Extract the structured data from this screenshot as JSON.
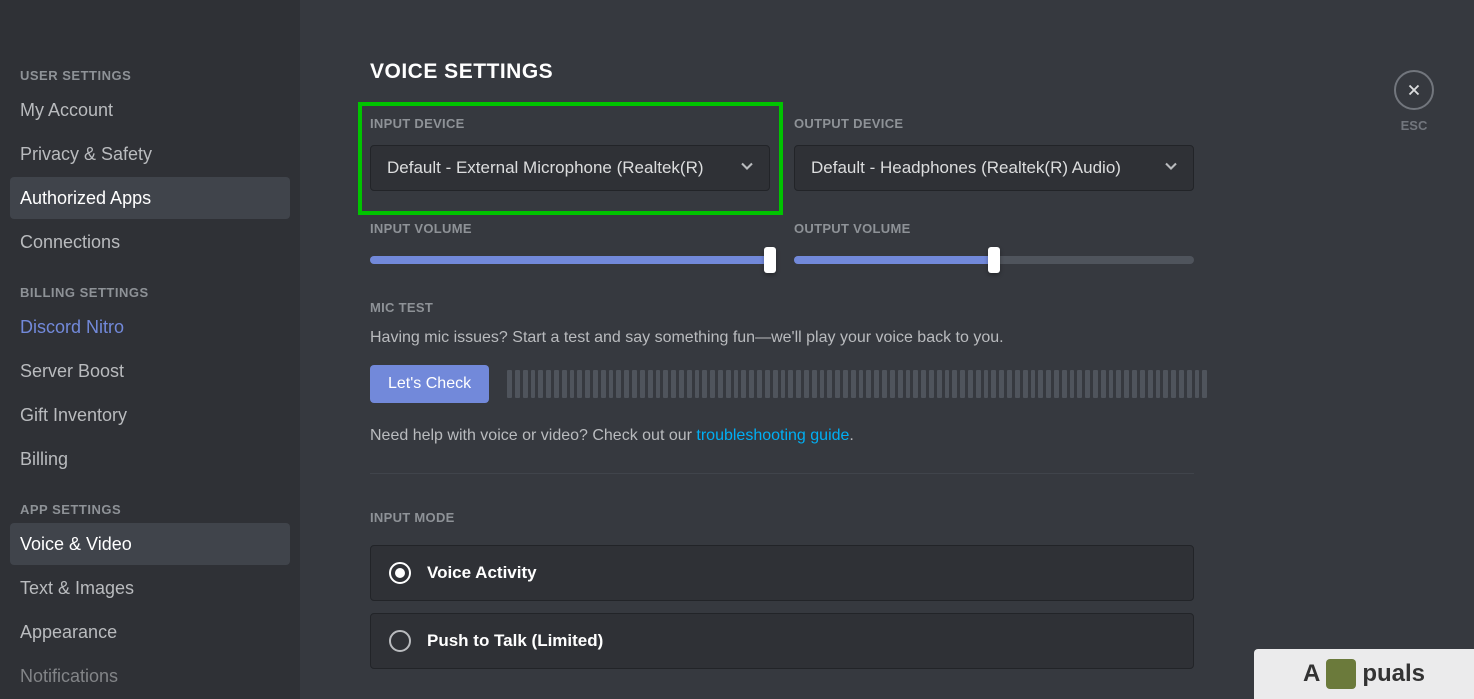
{
  "sidebar": {
    "user_settings_header": "USER SETTINGS",
    "billing_settings_header": "BILLING SETTINGS",
    "app_settings_header": "APP SETTINGS",
    "items": {
      "my_account": "My Account",
      "privacy_safety": "Privacy & Safety",
      "authorized_apps": "Authorized Apps",
      "connections": "Connections",
      "discord_nitro": "Discord Nitro",
      "server_boost": "Server Boost",
      "gift_inventory": "Gift Inventory",
      "billing": "Billing",
      "voice_video": "Voice & Video",
      "text_images": "Text & Images",
      "appearance": "Appearance",
      "notifications": "Notifications"
    }
  },
  "main": {
    "title": "VOICE SETTINGS",
    "input_device_label": "INPUT DEVICE",
    "input_device_value": "Default - External Microphone (Realtek(R)",
    "output_device_label": "OUTPUT DEVICE",
    "output_device_value": "Default - Headphones (Realtek(R) Audio)",
    "input_volume_label": "INPUT VOLUME",
    "output_volume_label": "OUTPUT VOLUME",
    "input_volume_percent": 100,
    "output_volume_percent": 50,
    "mic_test_label": "MIC TEST",
    "mic_test_desc": "Having mic issues? Start a test and say something fun—we'll play your voice back to you.",
    "lets_check_label": "Let's Check",
    "help_prefix": "Need help with voice or video? Check out our ",
    "help_link": "troubleshooting guide",
    "help_suffix": ".",
    "input_mode_label": "INPUT MODE",
    "voice_activity_label": "Voice Activity",
    "push_to_talk_label": "Push to Talk (Limited)"
  },
  "close": {
    "esc": "ESC"
  },
  "watermark": {
    "text": "A‎ ‎ ‎puals"
  }
}
